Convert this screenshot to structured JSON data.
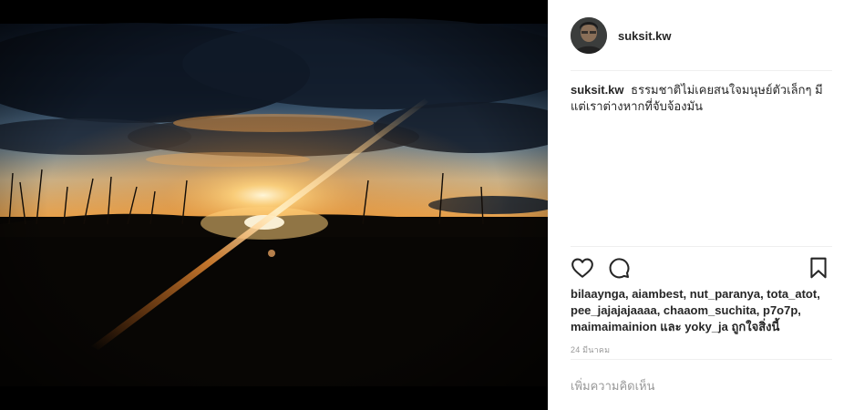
{
  "post": {
    "username": "suksit.kw",
    "caption_user": "suksit.kw",
    "caption_text": "ธรรมชาติไม่เคยสนใจมนุษย์ตัวเล็กๆ มีแต่เราต่างหากที่จับจ้องมัน",
    "likes_text": "bilaaynga, aiambest, nut_paranya, tota_atot, pee_jajajajaaaa, chaaom_suchita, p7o7p, maimaimainion และ yoky_ja ถูกใจสิ่งนี้",
    "date": "24 มีนาคม",
    "comment_placeholder": "เพิ่มความคิดเห็น"
  },
  "icons": {
    "like": "heart-icon",
    "comment": "comment-icon",
    "save": "bookmark-icon",
    "avatar": "user-avatar"
  },
  "colors": {
    "text": "#262626",
    "muted": "#999999",
    "divider": "#efefef",
    "photo_background": "#000000"
  }
}
